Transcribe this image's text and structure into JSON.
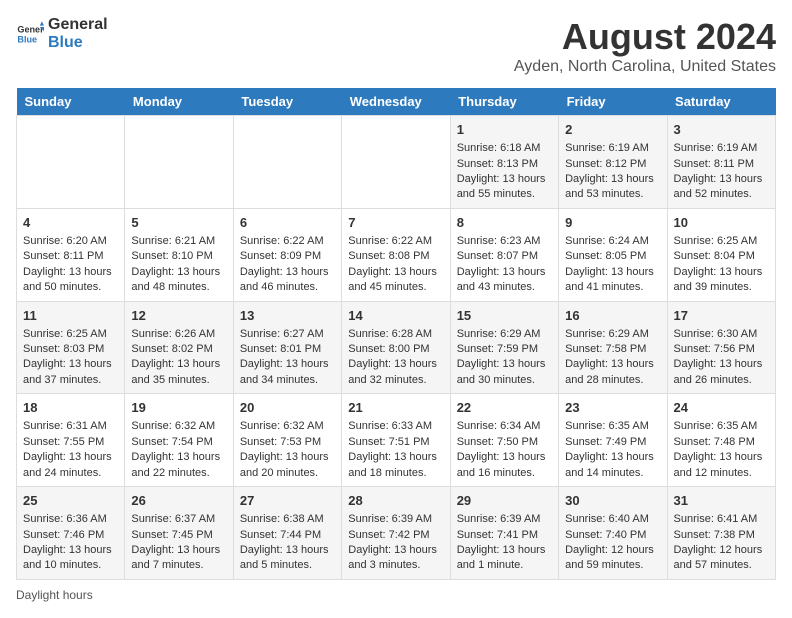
{
  "logo": {
    "general": "General",
    "blue": "Blue"
  },
  "title": "August 2024",
  "subtitle": "Ayden, North Carolina, United States",
  "days_of_week": [
    "Sunday",
    "Monday",
    "Tuesday",
    "Wednesday",
    "Thursday",
    "Friday",
    "Saturday"
  ],
  "footer_label": "Daylight hours",
  "weeks": [
    [
      {
        "day": "",
        "content": ""
      },
      {
        "day": "",
        "content": ""
      },
      {
        "day": "",
        "content": ""
      },
      {
        "day": "",
        "content": ""
      },
      {
        "day": "1",
        "content": "Sunrise: 6:18 AM\nSunset: 8:13 PM\nDaylight: 13 hours and 55 minutes."
      },
      {
        "day": "2",
        "content": "Sunrise: 6:19 AM\nSunset: 8:12 PM\nDaylight: 13 hours and 53 minutes."
      },
      {
        "day": "3",
        "content": "Sunrise: 6:19 AM\nSunset: 8:11 PM\nDaylight: 13 hours and 52 minutes."
      }
    ],
    [
      {
        "day": "4",
        "content": "Sunrise: 6:20 AM\nSunset: 8:11 PM\nDaylight: 13 hours and 50 minutes."
      },
      {
        "day": "5",
        "content": "Sunrise: 6:21 AM\nSunset: 8:10 PM\nDaylight: 13 hours and 48 minutes."
      },
      {
        "day": "6",
        "content": "Sunrise: 6:22 AM\nSunset: 8:09 PM\nDaylight: 13 hours and 46 minutes."
      },
      {
        "day": "7",
        "content": "Sunrise: 6:22 AM\nSunset: 8:08 PM\nDaylight: 13 hours and 45 minutes."
      },
      {
        "day": "8",
        "content": "Sunrise: 6:23 AM\nSunset: 8:07 PM\nDaylight: 13 hours and 43 minutes."
      },
      {
        "day": "9",
        "content": "Sunrise: 6:24 AM\nSunset: 8:05 PM\nDaylight: 13 hours and 41 minutes."
      },
      {
        "day": "10",
        "content": "Sunrise: 6:25 AM\nSunset: 8:04 PM\nDaylight: 13 hours and 39 minutes."
      }
    ],
    [
      {
        "day": "11",
        "content": "Sunrise: 6:25 AM\nSunset: 8:03 PM\nDaylight: 13 hours and 37 minutes."
      },
      {
        "day": "12",
        "content": "Sunrise: 6:26 AM\nSunset: 8:02 PM\nDaylight: 13 hours and 35 minutes."
      },
      {
        "day": "13",
        "content": "Sunrise: 6:27 AM\nSunset: 8:01 PM\nDaylight: 13 hours and 34 minutes."
      },
      {
        "day": "14",
        "content": "Sunrise: 6:28 AM\nSunset: 8:00 PM\nDaylight: 13 hours and 32 minutes."
      },
      {
        "day": "15",
        "content": "Sunrise: 6:29 AM\nSunset: 7:59 PM\nDaylight: 13 hours and 30 minutes."
      },
      {
        "day": "16",
        "content": "Sunrise: 6:29 AM\nSunset: 7:58 PM\nDaylight: 13 hours and 28 minutes."
      },
      {
        "day": "17",
        "content": "Sunrise: 6:30 AM\nSunset: 7:56 PM\nDaylight: 13 hours and 26 minutes."
      }
    ],
    [
      {
        "day": "18",
        "content": "Sunrise: 6:31 AM\nSunset: 7:55 PM\nDaylight: 13 hours and 24 minutes."
      },
      {
        "day": "19",
        "content": "Sunrise: 6:32 AM\nSunset: 7:54 PM\nDaylight: 13 hours and 22 minutes."
      },
      {
        "day": "20",
        "content": "Sunrise: 6:32 AM\nSunset: 7:53 PM\nDaylight: 13 hours and 20 minutes."
      },
      {
        "day": "21",
        "content": "Sunrise: 6:33 AM\nSunset: 7:51 PM\nDaylight: 13 hours and 18 minutes."
      },
      {
        "day": "22",
        "content": "Sunrise: 6:34 AM\nSunset: 7:50 PM\nDaylight: 13 hours and 16 minutes."
      },
      {
        "day": "23",
        "content": "Sunrise: 6:35 AM\nSunset: 7:49 PM\nDaylight: 13 hours and 14 minutes."
      },
      {
        "day": "24",
        "content": "Sunrise: 6:35 AM\nSunset: 7:48 PM\nDaylight: 13 hours and 12 minutes."
      }
    ],
    [
      {
        "day": "25",
        "content": "Sunrise: 6:36 AM\nSunset: 7:46 PM\nDaylight: 13 hours and 10 minutes."
      },
      {
        "day": "26",
        "content": "Sunrise: 6:37 AM\nSunset: 7:45 PM\nDaylight: 13 hours and 7 minutes."
      },
      {
        "day": "27",
        "content": "Sunrise: 6:38 AM\nSunset: 7:44 PM\nDaylight: 13 hours and 5 minutes."
      },
      {
        "day": "28",
        "content": "Sunrise: 6:39 AM\nSunset: 7:42 PM\nDaylight: 13 hours and 3 minutes."
      },
      {
        "day": "29",
        "content": "Sunrise: 6:39 AM\nSunset: 7:41 PM\nDaylight: 13 hours and 1 minute."
      },
      {
        "day": "30",
        "content": "Sunrise: 6:40 AM\nSunset: 7:40 PM\nDaylight: 12 hours and 59 minutes."
      },
      {
        "day": "31",
        "content": "Sunrise: 6:41 AM\nSunset: 7:38 PM\nDaylight: 12 hours and 57 minutes."
      }
    ]
  ]
}
